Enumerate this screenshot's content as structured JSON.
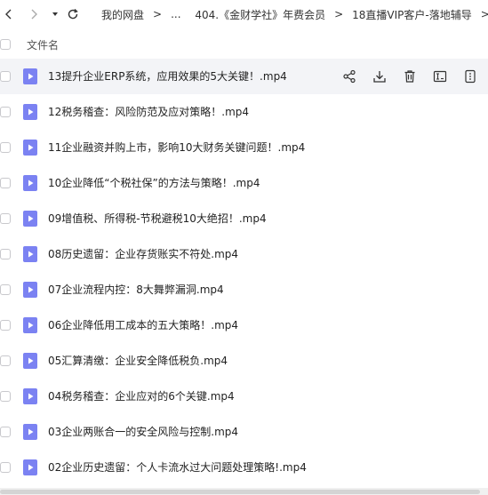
{
  "nav": {
    "breadcrumbs": [
      "我的网盘",
      "...",
      "404.《金财学社》年费会员",
      "18直播VIP客户-落地辅导",
      ">"
    ],
    "separator": ">"
  },
  "header": {
    "column_label": "文件名"
  },
  "files": [
    {
      "name": "13提升企业ERP系统，应用效果的5大关键！.mp4"
    },
    {
      "name": "12税务稽查：风险防范及应对策略！.mp4"
    },
    {
      "name": "11企业融资并购上市，影响10大财务关键问题！.mp4"
    },
    {
      "name": "10企业降低“个税社保”的方法与策略！.mp4"
    },
    {
      "name": "09增值税、所得税-节税避税10大绝招！.mp4"
    },
    {
      "name": "08历史遗留：企业存货账实不符处.mp4"
    },
    {
      "name": "07企业流程内控：8大舞弊漏洞.mp4"
    },
    {
      "name": "06企业降低用工成本的五大策略！.mp4"
    },
    {
      "name": "05汇算清缴：企业安全降低税负.mp4"
    },
    {
      "name": "04税务稽查：企业应对的6个关键.mp4"
    },
    {
      "name": "03企业两账合一的安全风险与控制.mp4"
    },
    {
      "name": "02企业历史遗留：个人卡流水过大问题处理策略!.mp4"
    }
  ],
  "colors": {
    "file_icon": "#7b82f2",
    "row_hover": "#f3f4f7",
    "icon_stroke": "#333333"
  }
}
